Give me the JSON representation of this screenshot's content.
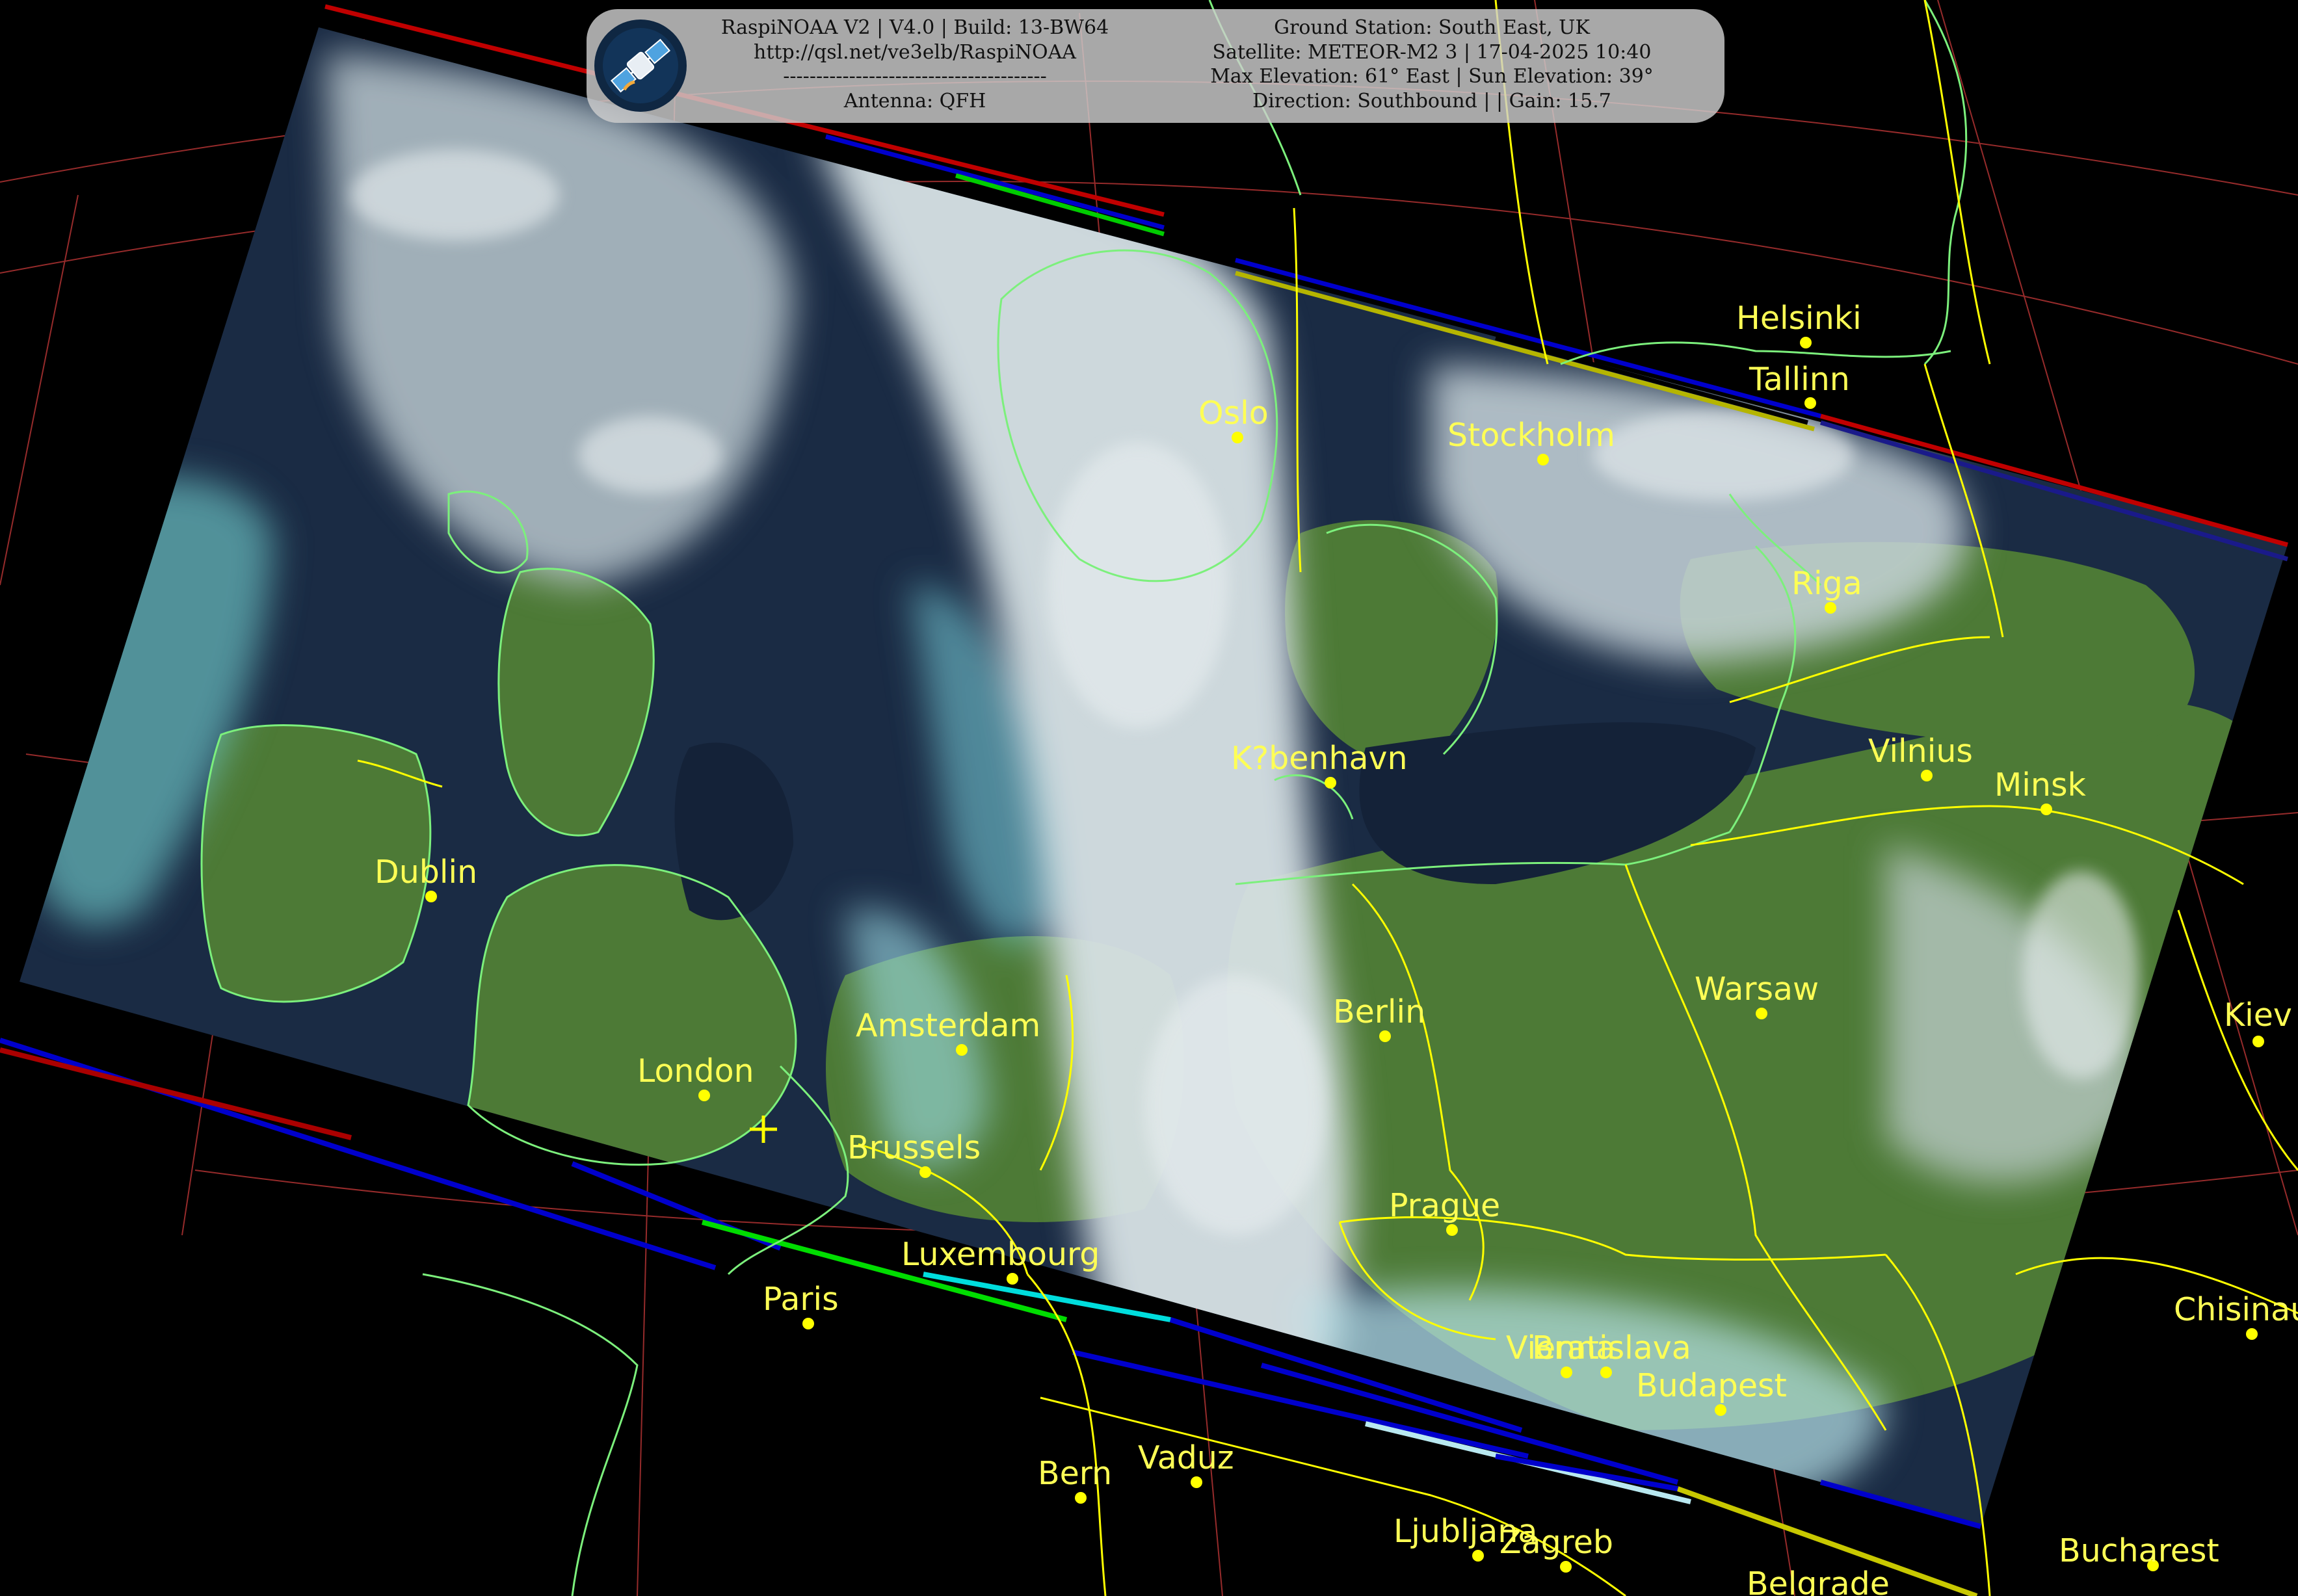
{
  "info_panel": {
    "left_lines": [
      "RaspiNOAA V2 | V4.0 | Build: 13-BW64",
      "http://qsl.net/ve3elb/RaspiNOAA",
      "----------------------------------------",
      "Antenna: QFH"
    ],
    "right_lines": [
      "Ground Station: South East, UK",
      "Satellite: METEOR-M2 3 | 17-04-2025 10:40",
      "Max Elevation: 61° East | Sun Elevation: 39°",
      "Direction: Southbound | | Gain: 15.7"
    ],
    "logo_icon": "satellite-icon"
  },
  "cities": [
    {
      "name": "Helsinki",
      "key": "helsinki"
    },
    {
      "name": "Tallinn",
      "key": "tallinn"
    },
    {
      "name": "Oslo",
      "key": "oslo"
    },
    {
      "name": "Stockholm",
      "key": "stockholm"
    },
    {
      "name": "Riga",
      "key": "riga"
    },
    {
      "name": "Vilnius",
      "key": "vilnius"
    },
    {
      "name": "Minsk",
      "key": "minsk"
    },
    {
      "name": "K?benhavn",
      "key": "kobenhavn"
    },
    {
      "name": "Dublin",
      "key": "dublin"
    },
    {
      "name": "Amsterdam",
      "key": "amsterdam"
    },
    {
      "name": "Berlin",
      "key": "berlin"
    },
    {
      "name": "Warsaw",
      "key": "warsaw"
    },
    {
      "name": "Kiev",
      "key": "kiev"
    },
    {
      "name": "London",
      "key": "london"
    },
    {
      "name": "Brussels",
      "key": "brussels"
    },
    {
      "name": "Prague",
      "key": "prague"
    },
    {
      "name": "Luxembourg",
      "key": "luxembourg"
    },
    {
      "name": "Paris",
      "key": "paris"
    },
    {
      "name": "Vienna",
      "key": "vienna"
    },
    {
      "name": "Bratislava",
      "key": "bratislava"
    },
    {
      "name": "Budapest",
      "key": "budapest"
    },
    {
      "name": "Chisinau",
      "key": "chisinau"
    },
    {
      "name": "Bern",
      "key": "bern"
    },
    {
      "name": "Vaduz",
      "key": "vaduz"
    },
    {
      "name": "Ljubljana",
      "key": "ljubljana"
    },
    {
      "name": "Zagreb",
      "key": "zagreb"
    },
    {
      "name": "Bucharest",
      "key": "bucharest"
    },
    {
      "name": "Belgrade",
      "key": "belgrade"
    }
  ],
  "colors": {
    "background": "#000000",
    "label": "#ffff55",
    "city_dot": "#ffff00",
    "coastline": "#7cf07c",
    "border": "#ffff00",
    "graticule": "#d23c3c",
    "land": "#4f7a35",
    "sea": "#1a2b44",
    "cloud": "#c9d6dc",
    "panel": "#cdcdcd"
  },
  "station_marker": "ground-station-icon"
}
